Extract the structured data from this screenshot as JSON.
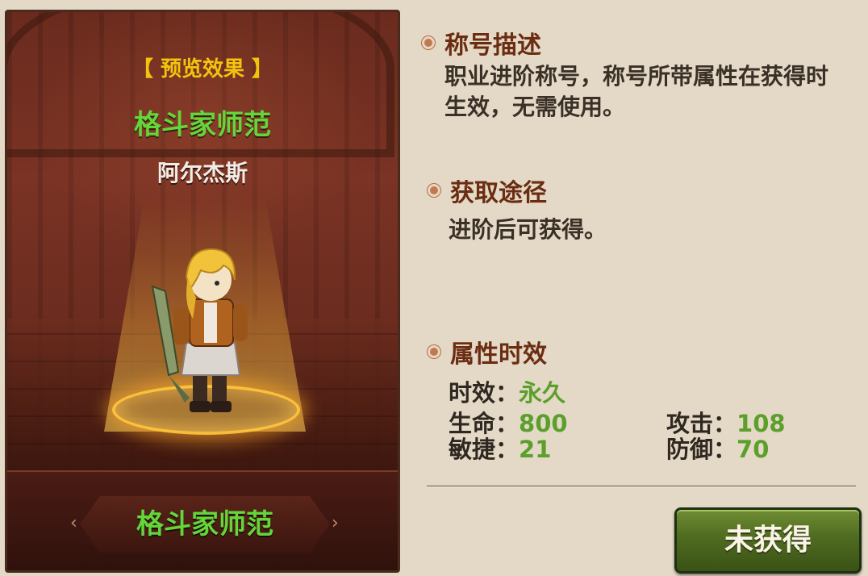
{
  "preview": {
    "header": "【 预览效果 】",
    "title": "格斗家师范",
    "character_name": "阿尔杰斯",
    "plate_title": "格斗家师范"
  },
  "sections": {
    "description": {
      "heading": "称号描述",
      "line1": "职业进阶称号，称号所带属性在获得时",
      "line2": "生效，无需使用。"
    },
    "acquire": {
      "heading": "获取途径",
      "text": "进阶后可获得。"
    },
    "attributes": {
      "heading": "属性时效",
      "duration_label": "时效：",
      "duration_value": "永久",
      "stats": {
        "hp_label": "生命：",
        "hp_value": "800",
        "attack_label": "攻击：",
        "attack_value": "108",
        "agility_label": "敏捷：",
        "agility_value": "21",
        "defense_label": "防御：",
        "defense_value": "70"
      }
    }
  },
  "status_button": {
    "label": "未获得"
  },
  "colors": {
    "title_green": "#63d63a",
    "header_gold": "#f2c40f",
    "section_brown": "#6a2d12",
    "stat_green": "#5c9f2b"
  }
}
